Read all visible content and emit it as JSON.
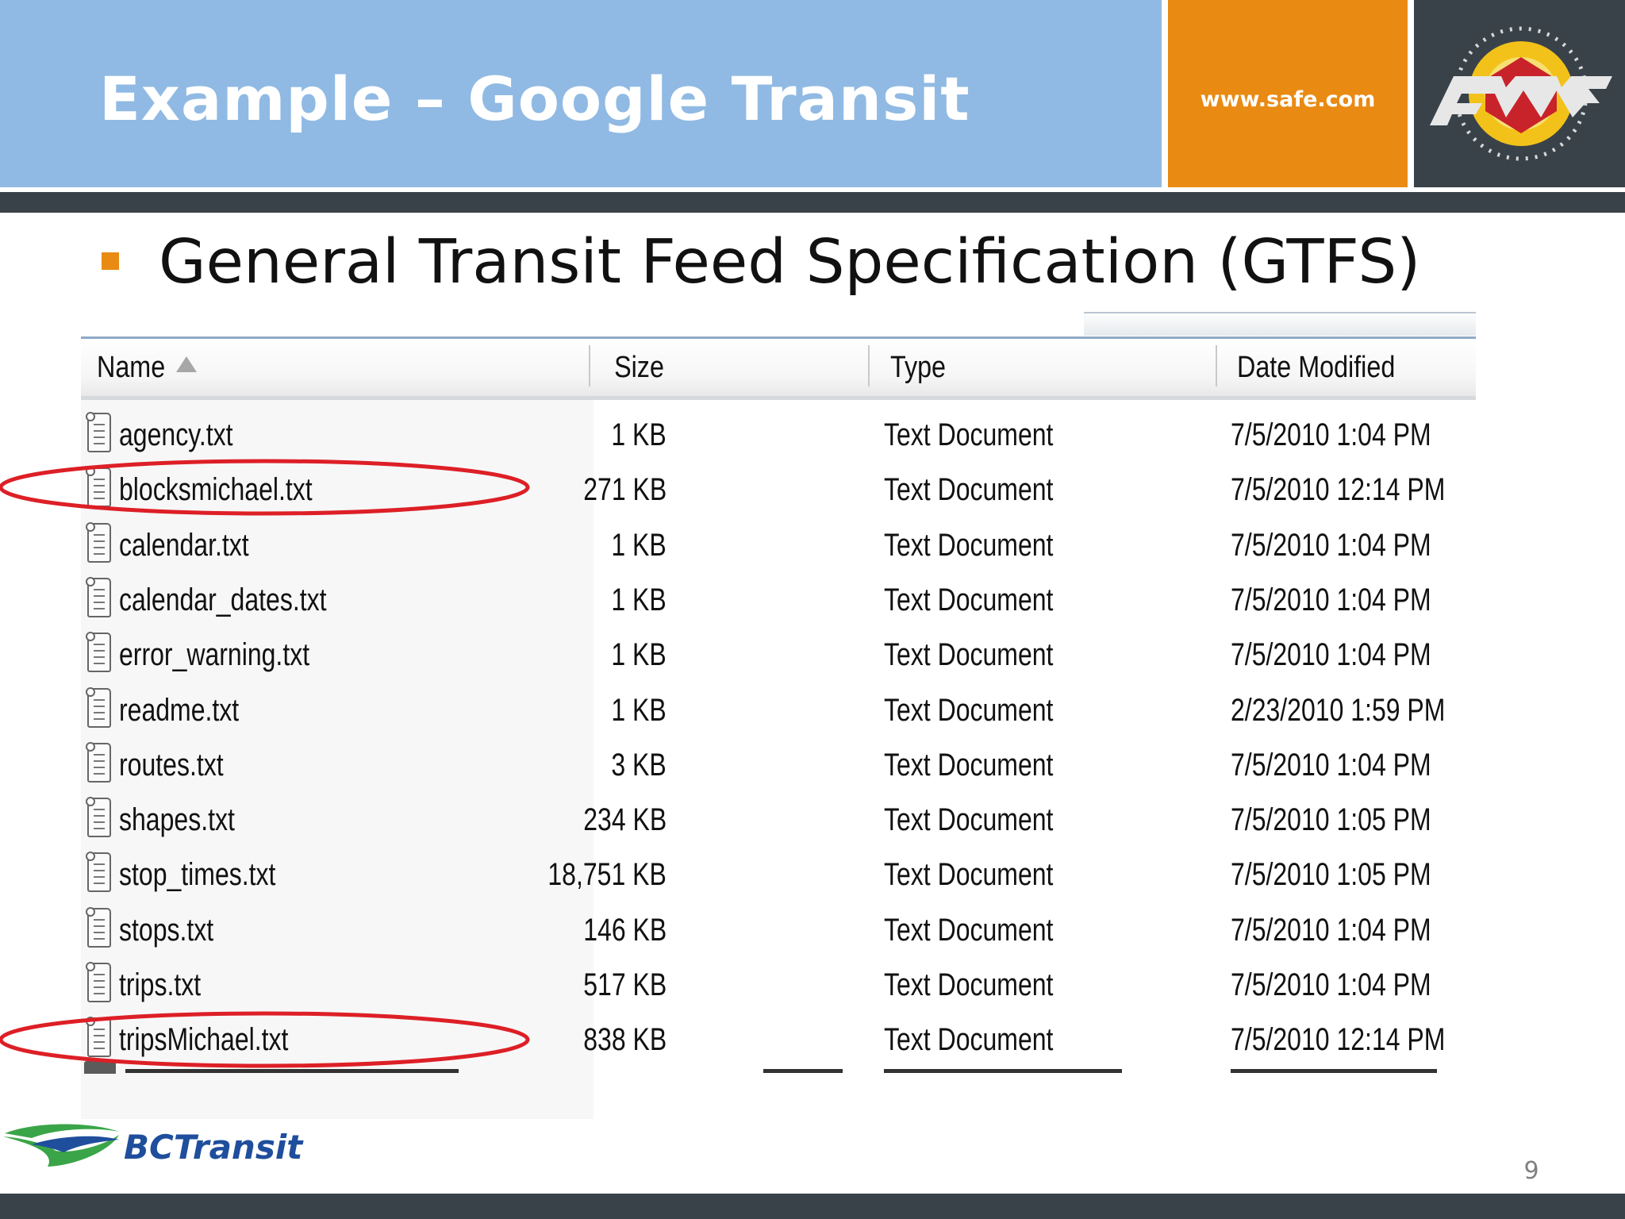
{
  "slide": {
    "title": "Example – Google Transit",
    "website": "www.safe.com",
    "bullet": "General Transit Feed Specification (GTFS)",
    "page_number": "9",
    "logo_text": "BCTransit"
  },
  "explorer": {
    "columns": {
      "name": "Name",
      "size": "Size",
      "type": "Type",
      "date": "Date Modified"
    },
    "sort_column": "name",
    "files": [
      {
        "name": "agency.txt",
        "size": "1 KB",
        "type": "Text Document",
        "date": "7/5/2010 1:04 PM",
        "highlighted": false
      },
      {
        "name": "blocksmichael.txt",
        "size": "271 KB",
        "type": "Text Document",
        "date": "7/5/2010 12:14 PM",
        "highlighted": true
      },
      {
        "name": "calendar.txt",
        "size": "1 KB",
        "type": "Text Document",
        "date": "7/5/2010 1:04 PM",
        "highlighted": false
      },
      {
        "name": "calendar_dates.txt",
        "size": "1 KB",
        "type": "Text Document",
        "date": "7/5/2010 1:04 PM",
        "highlighted": false
      },
      {
        "name": "error_warning.txt",
        "size": "1 KB",
        "type": "Text Document",
        "date": "7/5/2010 1:04 PM",
        "highlighted": false
      },
      {
        "name": "readme.txt",
        "size": "1 KB",
        "type": "Text Document",
        "date": "2/23/2010 1:59 PM",
        "highlighted": false
      },
      {
        "name": "routes.txt",
        "size": "3 KB",
        "type": "Text Document",
        "date": "7/5/2010 1:04 PM",
        "highlighted": false
      },
      {
        "name": "shapes.txt",
        "size": "234 KB",
        "type": "Text Document",
        "date": "7/5/2010 1:05 PM",
        "highlighted": false
      },
      {
        "name": "stop_times.txt",
        "size": "18,751 KB",
        "type": "Text Document",
        "date": "7/5/2010 1:05 PM",
        "highlighted": false
      },
      {
        "name": "stops.txt",
        "size": "146 KB",
        "type": "Text Document",
        "date": "7/5/2010 1:04 PM",
        "highlighted": false
      },
      {
        "name": "trips.txt",
        "size": "517 KB",
        "type": "Text Document",
        "date": "7/5/2010 1:04 PM",
        "highlighted": false
      },
      {
        "name": "tripsMichael.txt",
        "size": "838 KB",
        "type": "Text Document",
        "date": "7/5/2010 12:14 PM",
        "highlighted": true
      }
    ]
  },
  "colors": {
    "header_blue": "#90bae3",
    "accent_orange": "#e98a13",
    "dark_slate": "#3a4249",
    "highlight_red": "#dd1f26",
    "bctransit_blue": "#1f4e9c",
    "bctransit_green": "#3aa548"
  },
  "icons": {
    "file": "text-file-icon",
    "sort": "sort-ascending-icon",
    "brand": "fme-logo"
  }
}
